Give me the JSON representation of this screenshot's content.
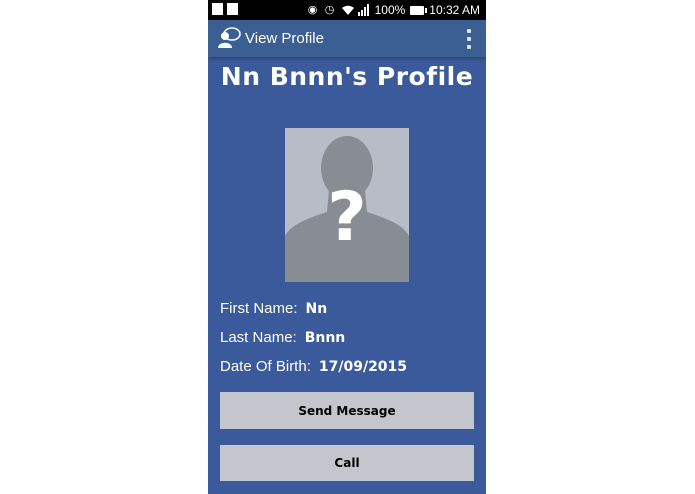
{
  "status_bar": {
    "battery": "100%",
    "time": "10:32 AM"
  },
  "action_bar": {
    "title": "View Profile"
  },
  "profile": {
    "heading": "Nn Bnnn's Profile",
    "fields": [
      {
        "label": "First Name:",
        "value": "Nn"
      },
      {
        "label": "Last Name:",
        "value": "Bnnn"
      },
      {
        "label": "Date Of Birth:",
        "value": "17/09/2015"
      }
    ]
  },
  "buttons": {
    "send_message": "Send Message",
    "call": "Call"
  },
  "colors": {
    "background": "#3a5a9b",
    "action_bar": "#3b5f93",
    "button": "#c3c6cd"
  }
}
